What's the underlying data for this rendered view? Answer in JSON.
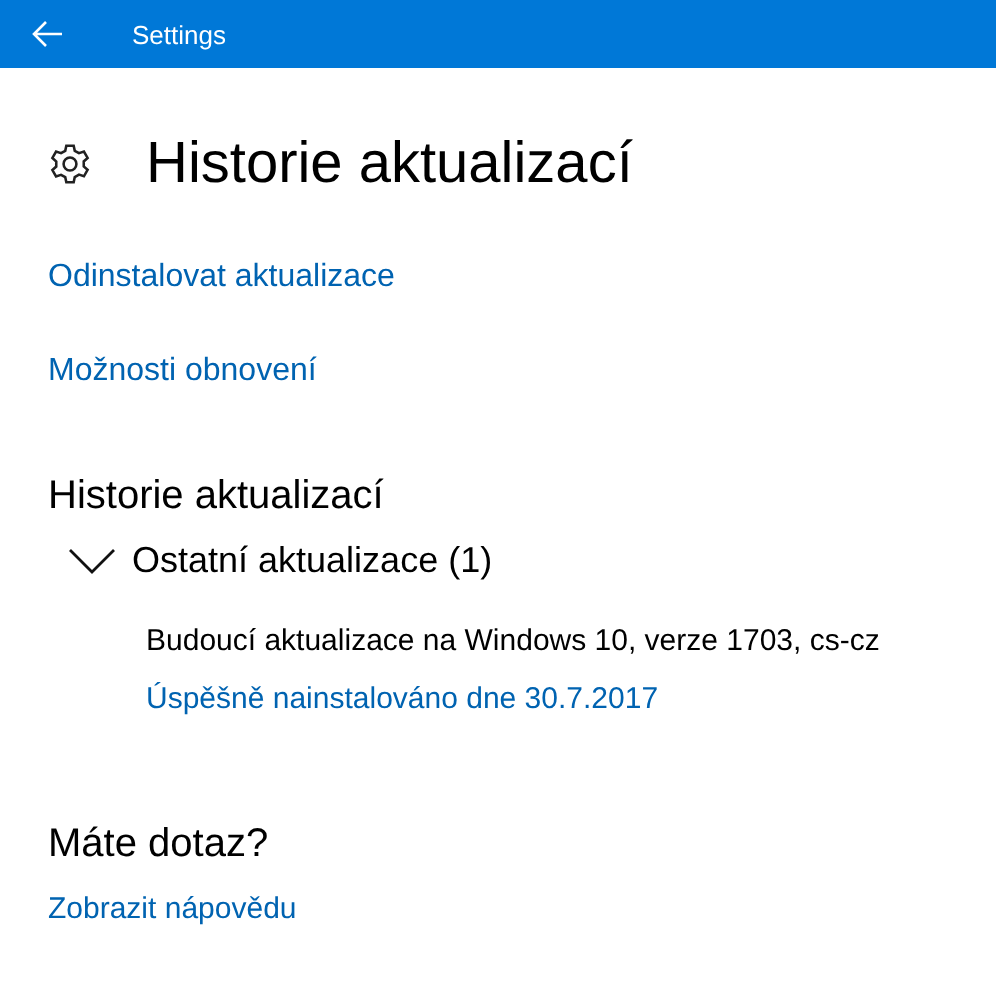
{
  "window": {
    "title": "Settings"
  },
  "page": {
    "title": "Historie aktualizací"
  },
  "links": [
    "Odinstalovat aktualizace",
    "Možnosti obnovení"
  ],
  "history": {
    "heading": "Historie aktualizací",
    "groups": [
      {
        "title": "Ostatní aktualizace (1)",
        "expanded": true,
        "items": [
          {
            "name": "Budoucí aktualizace na Windows 10, verze 1703, cs-cz",
            "status": "Úspěšně nainstalováno dne 30.7.2017"
          }
        ]
      }
    ]
  },
  "help": {
    "heading": "Máte dotaz?",
    "link": "Zobrazit nápovědu"
  }
}
